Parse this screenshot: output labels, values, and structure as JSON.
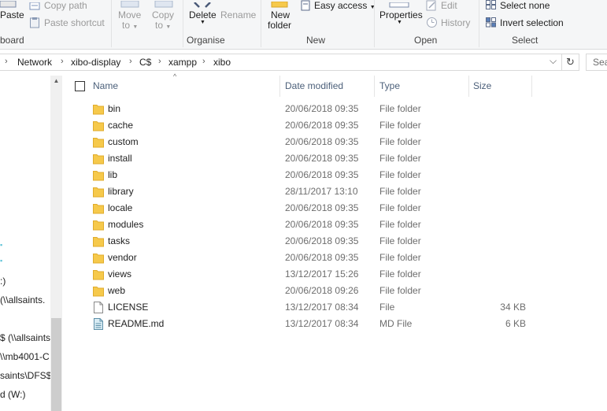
{
  "ribbon": {
    "clipboard": {
      "paste_label": "Paste",
      "copy_path_label": "Copy path",
      "paste_shortcut_label": "Paste shortcut",
      "group_label": "board"
    },
    "organise": {
      "move_to_label": "Move",
      "move_to_sub": "to",
      "copy_to_label": "Copy",
      "copy_to_sub": "to",
      "delete_label": "Delete",
      "rename_label": "Rename",
      "group_label": "Organise"
    },
    "new": {
      "new_folder_label": "New",
      "new_folder_sub": "folder",
      "easy_access_label": "Easy access",
      "group_label": "New"
    },
    "open": {
      "properties_label": "Properties",
      "edit_label": "Edit",
      "history_label": "History",
      "group_label": "Open"
    },
    "select": {
      "select_none_label": "Select none",
      "invert_selection_label": "Invert selection",
      "group_label": "Select"
    }
  },
  "address": {
    "crumbs": [
      "Network",
      "xibo-display",
      "C$",
      "xampp",
      "xibo"
    ],
    "search_placeholder": "Sea"
  },
  "nav": {
    "items": [
      ":)",
      " (\\\\allsaints.",
      "$ (\\\\allsaints",
      "\\\\mb4001-C",
      "saints\\DFS$) (",
      "d (W:)"
    ]
  },
  "columns": {
    "name": "Name",
    "date": "Date modified",
    "type": "Type",
    "size": "Size"
  },
  "files": [
    {
      "name": "bin",
      "date": "20/06/2018 09:35",
      "type": "File folder",
      "size": "",
      "icon": "folder-icon"
    },
    {
      "name": "cache",
      "date": "20/06/2018 09:35",
      "type": "File folder",
      "size": "",
      "icon": "folder-icon"
    },
    {
      "name": "custom",
      "date": "20/06/2018 09:35",
      "type": "File folder",
      "size": "",
      "icon": "folder-icon"
    },
    {
      "name": "install",
      "date": "20/06/2018 09:35",
      "type": "File folder",
      "size": "",
      "icon": "folder-icon"
    },
    {
      "name": "lib",
      "date": "20/06/2018 09:35",
      "type": "File folder",
      "size": "",
      "icon": "folder-icon"
    },
    {
      "name": "library",
      "date": "28/11/2017 13:10",
      "type": "File folder",
      "size": "",
      "icon": "folder-icon"
    },
    {
      "name": "locale",
      "date": "20/06/2018 09:35",
      "type": "File folder",
      "size": "",
      "icon": "folder-icon"
    },
    {
      "name": "modules",
      "date": "20/06/2018 09:35",
      "type": "File folder",
      "size": "",
      "icon": "folder-icon"
    },
    {
      "name": "tasks",
      "date": "20/06/2018 09:35",
      "type": "File folder",
      "size": "",
      "icon": "folder-icon"
    },
    {
      "name": "vendor",
      "date": "20/06/2018 09:35",
      "type": "File folder",
      "size": "",
      "icon": "folder-icon"
    },
    {
      "name": "views",
      "date": "13/12/2017 15:26",
      "type": "File folder",
      "size": "",
      "icon": "folder-icon"
    },
    {
      "name": "web",
      "date": "20/06/2018 09:26",
      "type": "File folder",
      "size": "",
      "icon": "folder-icon"
    },
    {
      "name": "LICENSE",
      "date": "13/12/2017 08:34",
      "type": "File",
      "size": "34 KB",
      "icon": "file-icon"
    },
    {
      "name": "README.md",
      "date": "13/12/2017 08:34",
      "type": "MD File",
      "size": "6 KB",
      "icon": "md-file-icon"
    }
  ],
  "colors": {
    "folder": "#f6c94b",
    "header_text": "#4c607a",
    "ribbon_bg": "#f5f6f7"
  }
}
